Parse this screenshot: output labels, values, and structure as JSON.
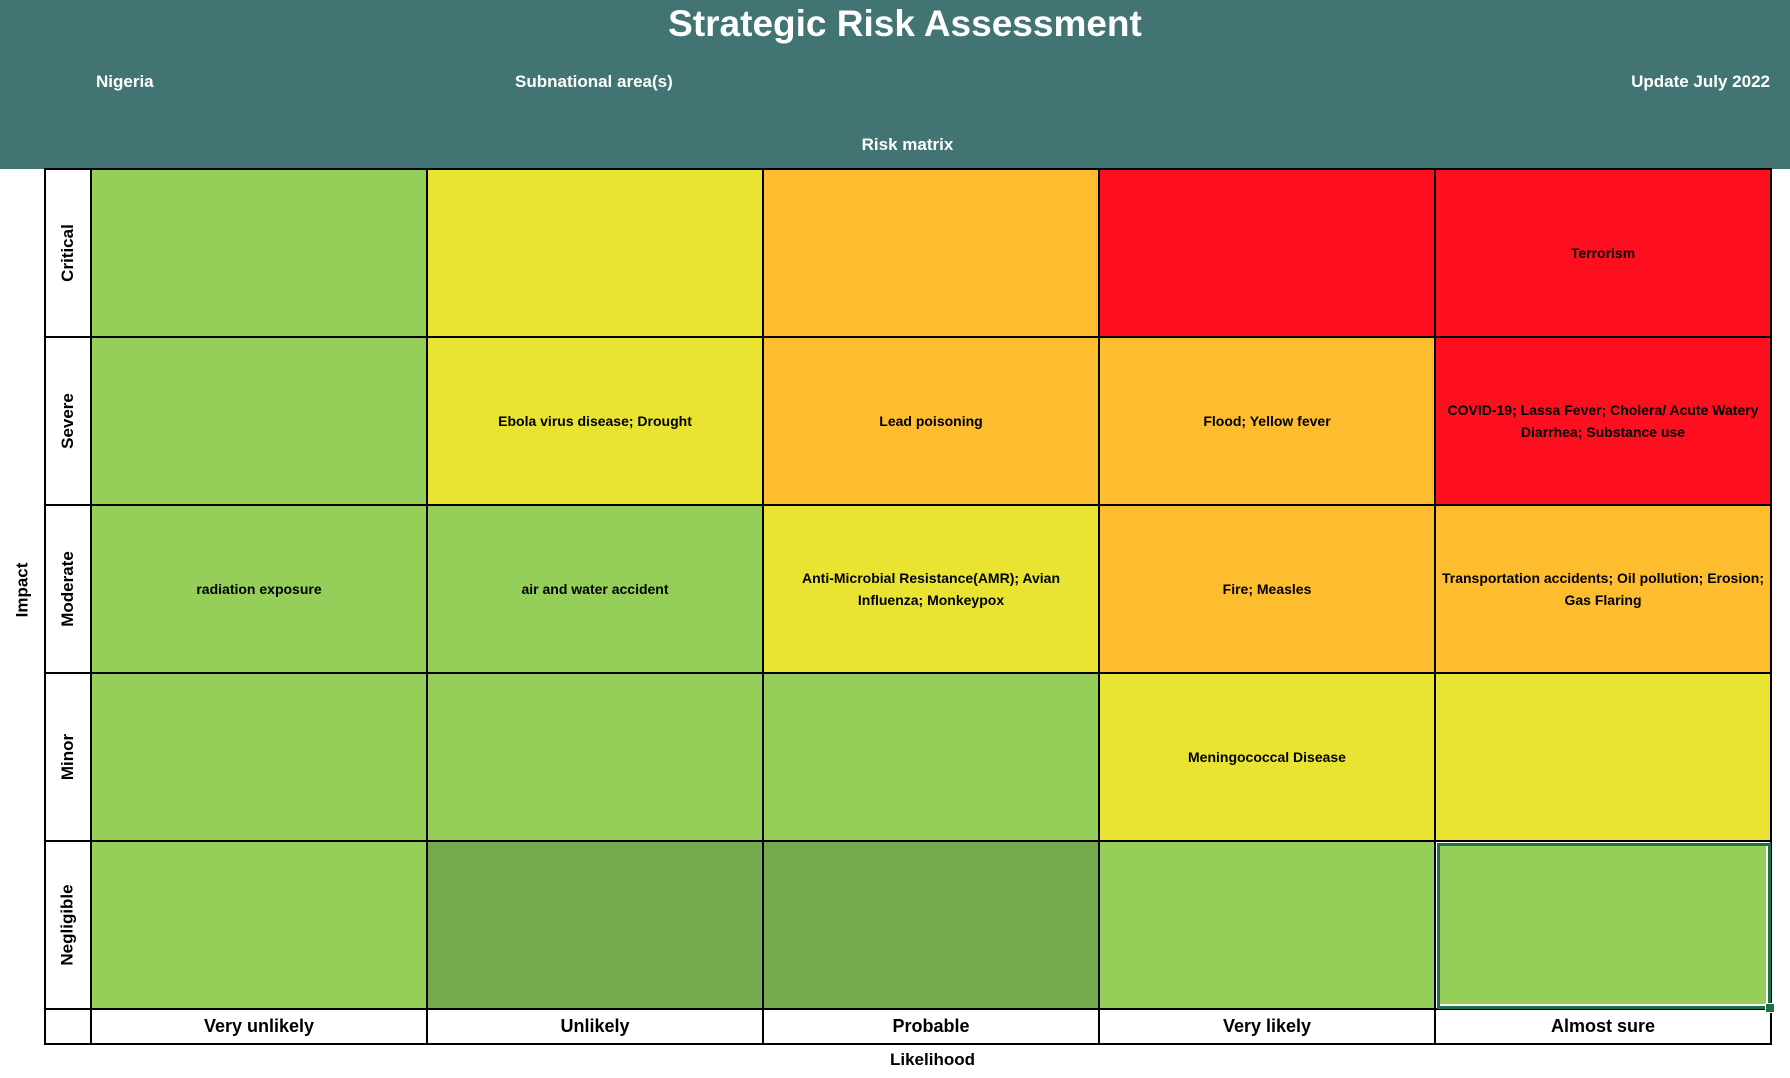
{
  "header": {
    "title": "Strategic Risk Assessment",
    "country": "Nigeria",
    "subnational": "Subnational area(s)",
    "update": "Update July 2022",
    "subtitle": "Risk matrix"
  },
  "axes": {
    "y_label": "Impact",
    "x_label": "Likelihood"
  },
  "columns": [
    "Very unlikely",
    "Unlikely",
    "Probable",
    "Very likely",
    "Almost sure"
  ],
  "rows": [
    {
      "label": "Critical",
      "cells": [
        {
          "text": "",
          "color": "#95cf5a"
        },
        {
          "text": "",
          "color": "#e9e432"
        },
        {
          "text": "",
          "color": "#fdbd2e"
        },
        {
          "text": "",
          "color": "#fd0f1f"
        },
        {
          "text": "Terrorism",
          "color": "#fd0f1f"
        }
      ]
    },
    {
      "label": "Severe",
      "cells": [
        {
          "text": "",
          "color": "#95cf5a"
        },
        {
          "text": "Ebola virus disease; Drought",
          "color": "#e9e432"
        },
        {
          "text": "Lead poisoning",
          "color": "#fdbd2e"
        },
        {
          "text": "Flood; Yellow fever",
          "color": "#fdbd2e"
        },
        {
          "text": "COVID-19; Lassa Fever; Cholera/ Acute Watery Diarrhea; Substance use",
          "color": "#fd0f1f"
        }
      ]
    },
    {
      "label": "Moderate",
      "cells": [
        {
          "text": "radiation exposure",
          "color": "#95cf5a"
        },
        {
          "text": "air and water accident",
          "color": "#95cf5a"
        },
        {
          "text": "Anti-Microbial Resistance(AMR); Avian Influenza; Monkeypox",
          "color": "#e9e432"
        },
        {
          "text": "Fire; Measles",
          "color": "#fdbd2e"
        },
        {
          "text": "Transportation accidents; Oil pollution; Erosion; Gas Flaring",
          "color": "#fdbd2e"
        }
      ]
    },
    {
      "label": "Minor",
      "cells": [
        {
          "text": "",
          "color": "#95cf5a"
        },
        {
          "text": "",
          "color": "#95cf5a"
        },
        {
          "text": "",
          "color": "#95cf5a"
        },
        {
          "text": "Meningococcal Disease",
          "color": "#e9e432"
        },
        {
          "text": "",
          "color": "#e9e432"
        }
      ]
    },
    {
      "label": "Negligible",
      "cells": [
        {
          "text": "",
          "color": "#95cf5a"
        },
        {
          "text": "",
          "color": "#75ab4e"
        },
        {
          "text": "",
          "color": "#75ab4e"
        },
        {
          "text": "",
          "color": "#95cf5a"
        },
        {
          "text": "",
          "color": "#95cf5a"
        }
      ]
    }
  ]
}
